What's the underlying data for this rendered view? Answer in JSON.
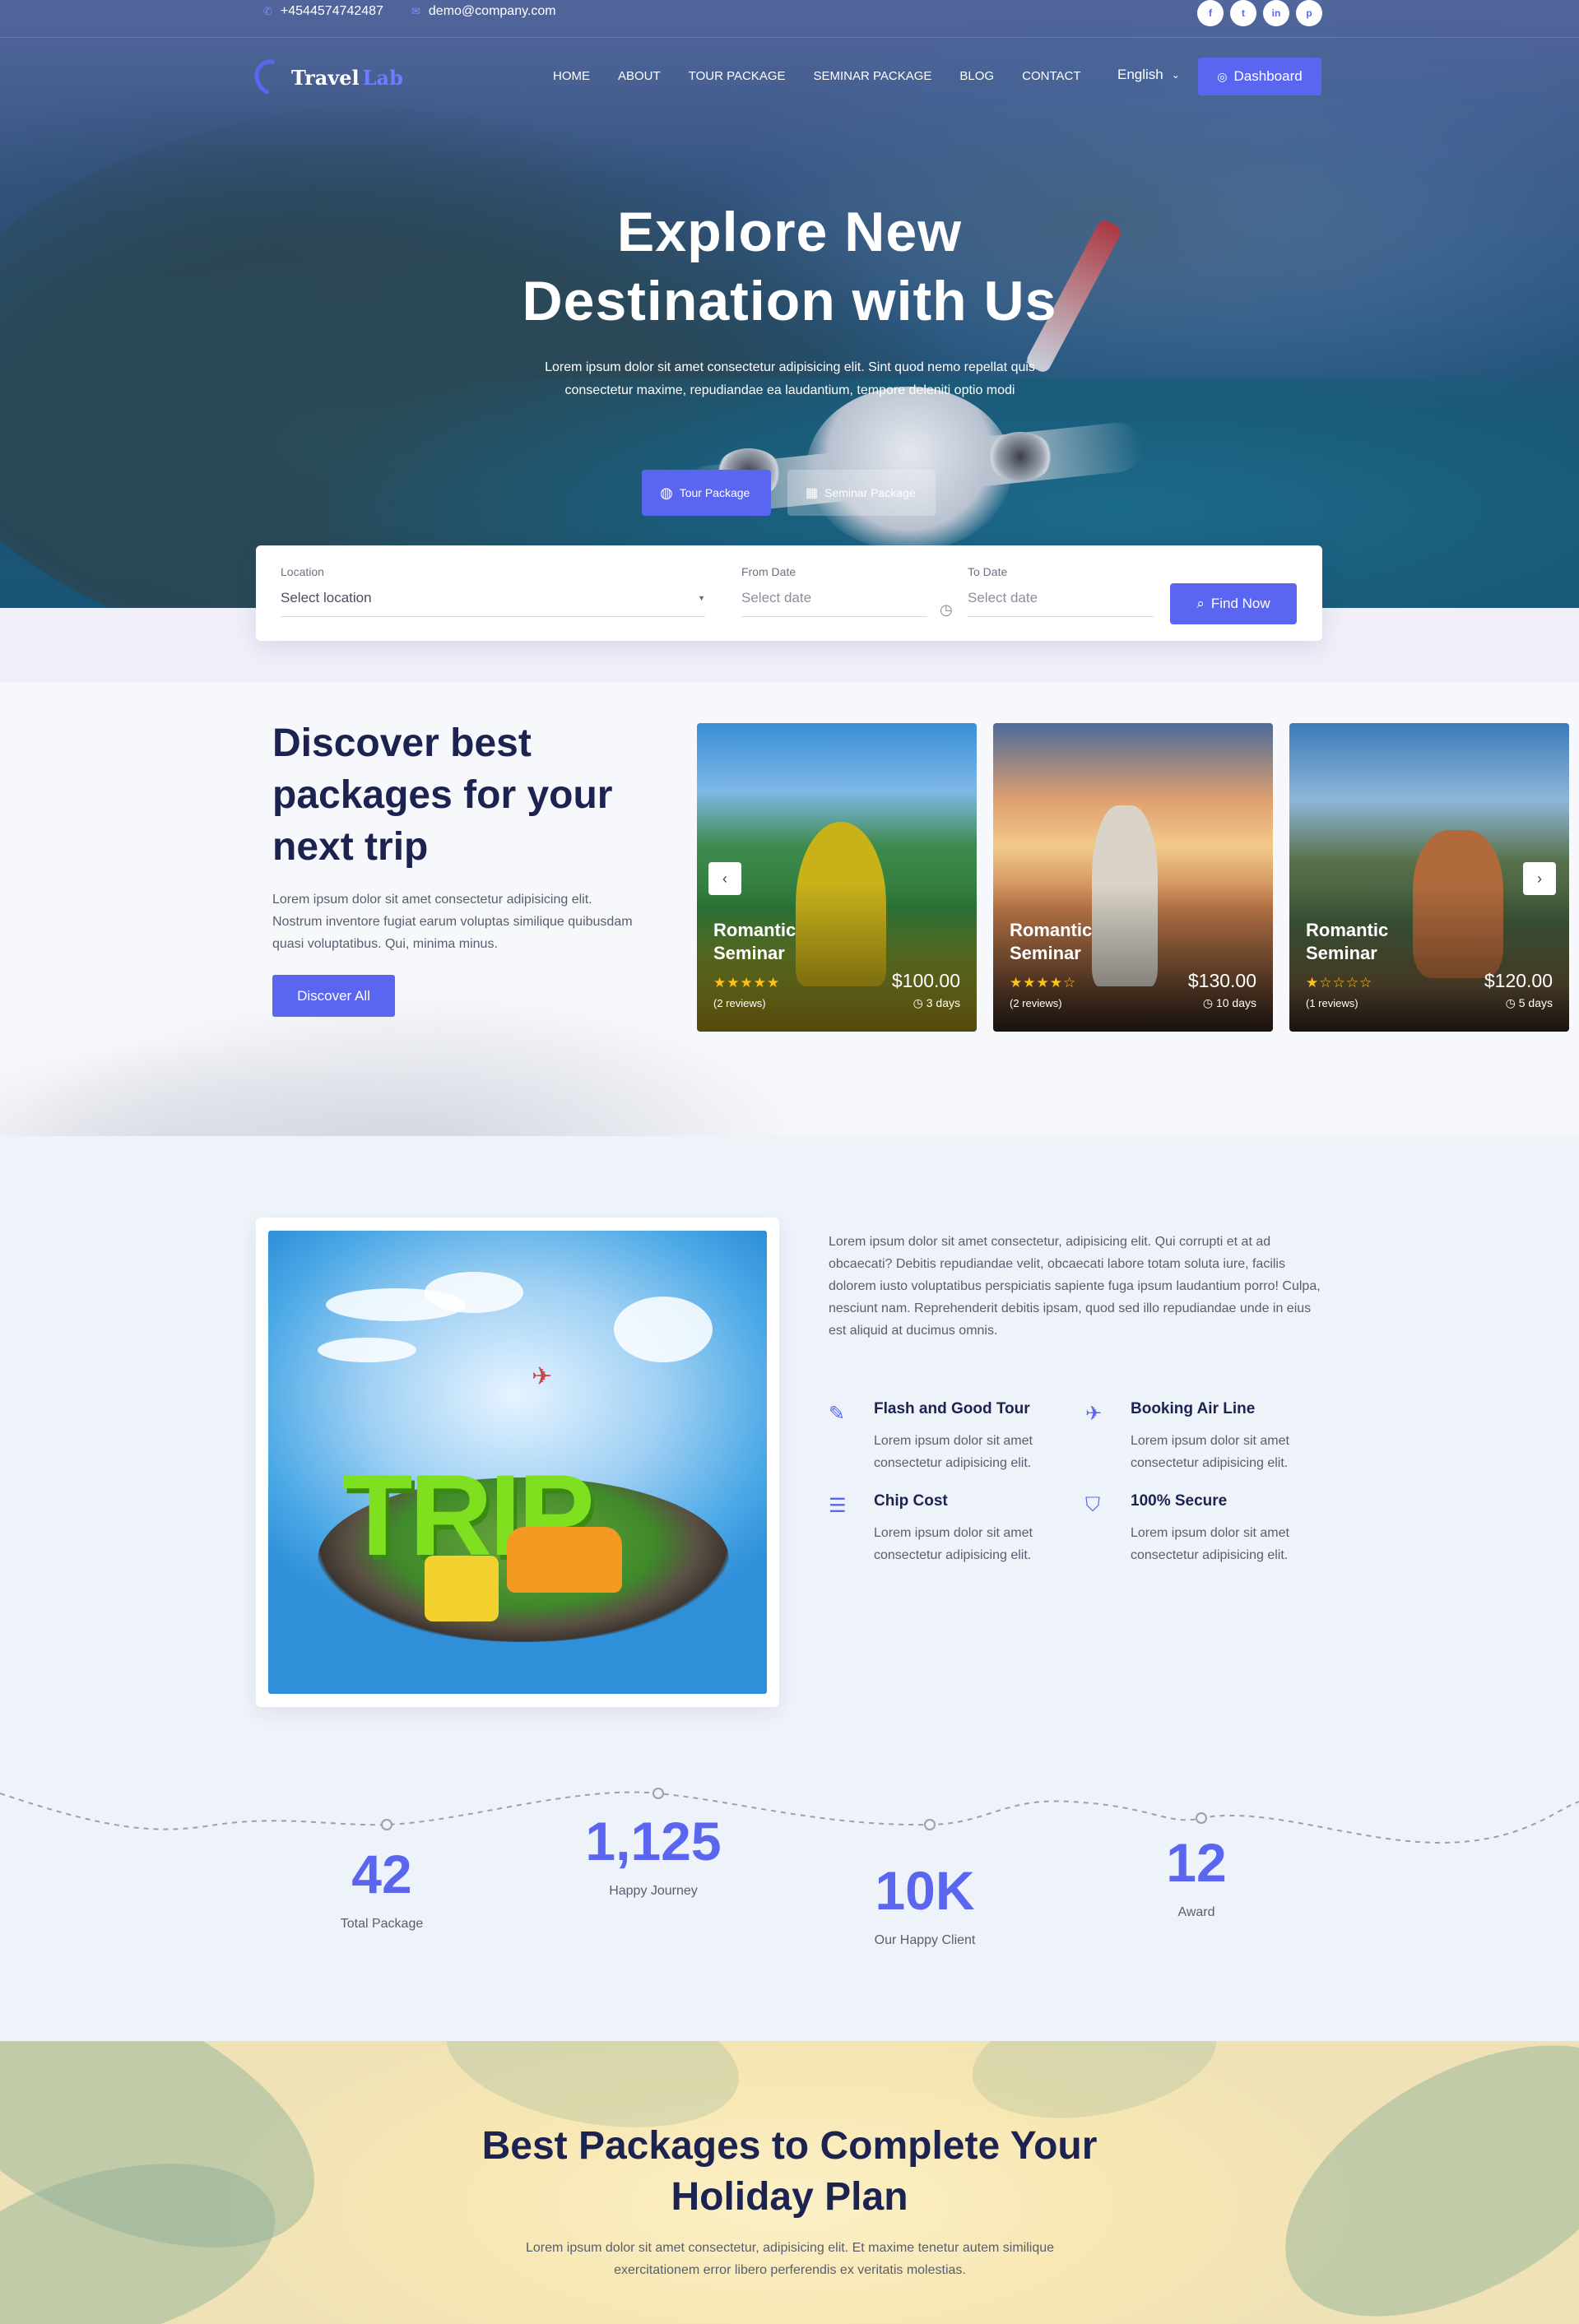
{
  "topbar": {
    "phone": "+4544574742487",
    "email": "demo@company.com",
    "social": [
      "f",
      "t",
      "in",
      "p"
    ]
  },
  "nav": {
    "logo_a": "Travel",
    "logo_b": "Lab",
    "items": [
      "HOME",
      "ABOUT",
      "TOUR PACKAGE",
      "SEMINAR PACKAGE",
      "BLOG",
      "CONTACT"
    ],
    "language": "English",
    "dashboard": "Dashboard"
  },
  "hero": {
    "title_line1": "Explore New",
    "title_line2": "Destination with Us",
    "subtitle_line1": "Lorem ipsum dolor sit amet consectetur adipisicing elit. Sint quod nemo repellat quis",
    "subtitle_line2": "consectetur maxime, repudiandae ea laudantium, tempore deleniti optio modi",
    "btn_tour": "Tour Package",
    "btn_seminar": "Seminar Package"
  },
  "search": {
    "location_label": "Location",
    "location_value": "Select location",
    "from_label": "From Date",
    "from_placeholder": "Select date",
    "to_label": "To Date",
    "to_placeholder": "Select date",
    "button": "Find Now"
  },
  "discover": {
    "title": "Discover best packages for your next trip",
    "text": "Lorem ipsum dolor sit amet consectetur adipisicing elit. Nostrum inventore fugiat earum voluptas similique quibusdam quasi voluptatibus. Qui, minima minus.",
    "button": "Discover All",
    "cards": [
      {
        "title_a": "Romantic",
        "title_b": "Seminar",
        "stars": "★★★★★",
        "reviews": "(2 reviews)",
        "price": "$100.00",
        "days": "3 days"
      },
      {
        "title_a": "Romantic",
        "title_b": "Seminar",
        "stars": "★★★★☆",
        "reviews": "(2 reviews)",
        "price": "$130.00",
        "days": "10 days"
      },
      {
        "title_a": "Romantic",
        "title_b": "Seminar",
        "stars": "★☆☆☆☆",
        "reviews": "(1 reviews)",
        "price": "$120.00",
        "days": "5 days"
      }
    ]
  },
  "about": {
    "image_word": "TRIP",
    "text": "Lorem ipsum dolor sit amet consectetur, adipisicing elit. Qui corrupti et at ad obcaecati? Debitis repudiandae velit, obcaecati labore totam soluta iure, facilis dolorem iusto voluptatibus perspiciatis sapiente fuga ipsum laudantium porro! Culpa, nesciunt nam. Reprehenderit debitis ipsam, quod sed illo repudiandae unde in eius est aliquid at ducimus omnis.",
    "features": [
      {
        "title": "Flash and Good Tour",
        "text": "Lorem ipsum dolor sit amet consectetur adipisicing elit."
      },
      {
        "title": "Booking Air Line",
        "text": "Lorem ipsum dolor sit amet consectetur adipisicing elit."
      },
      {
        "title": "Chip Cost",
        "text": "Lorem ipsum dolor sit amet consectetur adipisicing elit."
      },
      {
        "title": "100% Secure",
        "text": "Lorem ipsum dolor sit amet consectetur adipisicing elit."
      }
    ]
  },
  "stats": [
    {
      "number": "42",
      "label": "Total Package"
    },
    {
      "number": "1,125",
      "label": "Happy Journey"
    },
    {
      "number": "10K",
      "label": "Our Happy Client"
    },
    {
      "number": "12",
      "label": "Award"
    }
  ],
  "packages": {
    "title_line1": "Best Packages to Complete Your",
    "title_line2": "Holiday Plan",
    "subtitle": "Lorem ipsum dolor sit amet consectetur, adipisicing elit. Et maxime tenetur autem similique exercitationem error libero perferendis ex veritatis molestias."
  },
  "colors": {
    "accent": "#5b66f0",
    "heading": "#1d2350",
    "star": "#ffc21a"
  }
}
